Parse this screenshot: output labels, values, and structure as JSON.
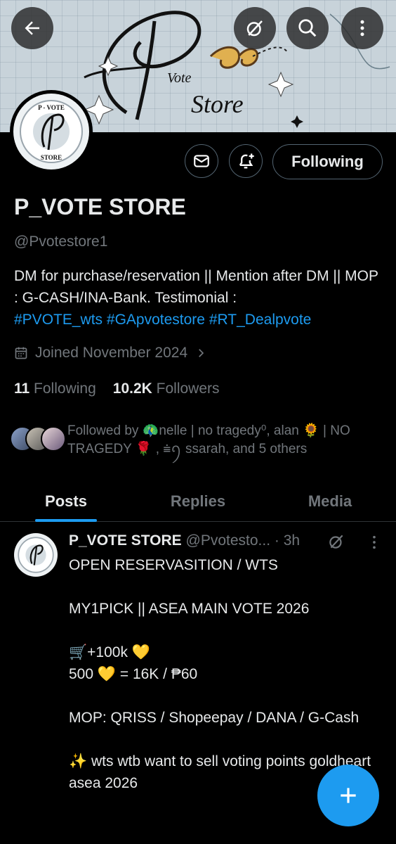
{
  "profile": {
    "name": "P_VOTE STORE",
    "handle": "@Pvotestore1",
    "bio_plain": "DM for purchase/reservation || Mention after DM || MOP : G-CASH/INA-Bank.  Testimonial :",
    "bio_tags": [
      "#PVOTE_wts",
      "#GApvotestore",
      "#RT_Dealpvote"
    ],
    "joined": "Joined November 2024",
    "following_count": "11",
    "following_label": "Following",
    "followers_count": "10.2K",
    "followers_label": "Followers",
    "followed_by": "Followed by 🦚nelle | no tragedy⁰, alan 🌻 | NO TRAGEDY 🌹 , ⩧ꪆ ssarah, and 5 others",
    "follow_button": "Following"
  },
  "banner": {
    "logo_line1": "Vote",
    "logo_line2": "Store"
  },
  "avatar_logo": {
    "top": "P - VOTE",
    "bottom": "STORE"
  },
  "tabs": [
    {
      "label": "Posts",
      "active": true
    },
    {
      "label": "Replies",
      "active": false
    },
    {
      "label": "Media",
      "active": false
    }
  ],
  "post": {
    "author": "P_VOTE STORE",
    "handle_time": "@Pvotesto... · 3h",
    "lines": [
      "OPEN RESERVASITION / WTS",
      "",
      "MY1PICK || ASEA MAIN VOTE 2026",
      "",
      "🛒+100k 💛",
      "500 💛 = 16K / ₱60",
      "",
      "MOP: QRISS / Shopeepay / DANA / G-Cash",
      "",
      "✨ wts wtb want to sell voting points goldheart asea 2026"
    ]
  },
  "colors": {
    "accent": "#1d9bf0",
    "background": "#000000",
    "text": "#e7e9ea",
    "muted": "#71767b"
  },
  "icons": [
    "back-arrow-icon",
    "grok-icon",
    "search-icon",
    "more-icon",
    "mail-icon",
    "bell-plus-icon",
    "calendar-icon",
    "chevron-right-icon",
    "compose-plus-icon"
  ]
}
